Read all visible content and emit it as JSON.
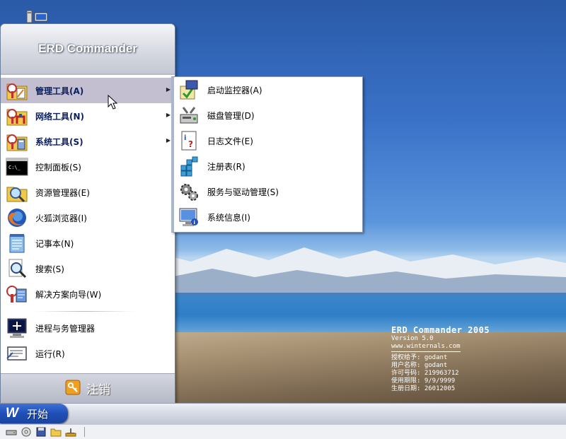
{
  "app": {
    "title": "ERD Commander"
  },
  "start_menu": {
    "header_title": "ERD Commander",
    "items": [
      {
        "label": "管理工具(A)",
        "icon": "admin-tools-icon",
        "submenu": true,
        "bold": true,
        "active": true
      },
      {
        "label": "网络工具(N)",
        "icon": "network-tools-icon",
        "submenu": true,
        "bold": true
      },
      {
        "label": "系统工具(S)",
        "icon": "system-tools-icon",
        "submenu": true,
        "bold": true
      },
      {
        "label": "控制面板(S)",
        "icon": "console-icon"
      },
      {
        "label": "资源管理器(E)",
        "icon": "explorer-icon"
      },
      {
        "label": "火狐浏览器(I)",
        "icon": "firefox-icon"
      },
      {
        "label": "记事本(N)",
        "icon": "notepad-icon"
      },
      {
        "label": "搜索(S)",
        "icon": "search-icon"
      },
      {
        "label": "解决方案向导(W)",
        "icon": "wizard-icon"
      },
      {
        "label": "进程与务管理器",
        "icon": "task-manager-icon"
      },
      {
        "label": "运行(R)",
        "icon": "run-icon"
      }
    ],
    "logoff_label": "注销"
  },
  "submenu": {
    "items": [
      {
        "label": "启动监控器(A)",
        "icon": "autoruns-icon"
      },
      {
        "label": "磁盘管理(D)",
        "icon": "disk-management-icon"
      },
      {
        "label": "日志文件(E)",
        "icon": "log-file-icon"
      },
      {
        "label": "注册表(R)",
        "icon": "registry-icon"
      },
      {
        "label": "服务与驱动管理(S)",
        "icon": "services-icon"
      },
      {
        "label": "系统信息(I)",
        "icon": "system-info-icon"
      }
    ]
  },
  "taskbar": {
    "start_label": "开始",
    "start_logo": "W"
  },
  "wallpaper_info": {
    "title": "ERD Commander 2005",
    "version": "Version 5.0",
    "url": "www.winternals.com",
    "lines": [
      "授权给予: godant",
      "用户名称: godant",
      "许可号码: 219963712",
      "使用期限: 9/9/9999",
      "生册日期: 26012005"
    ]
  },
  "colors": {
    "menu_active": "#c3bfd0",
    "start_button": "#1f4fb6",
    "label_bold": "#0b1f5e"
  }
}
